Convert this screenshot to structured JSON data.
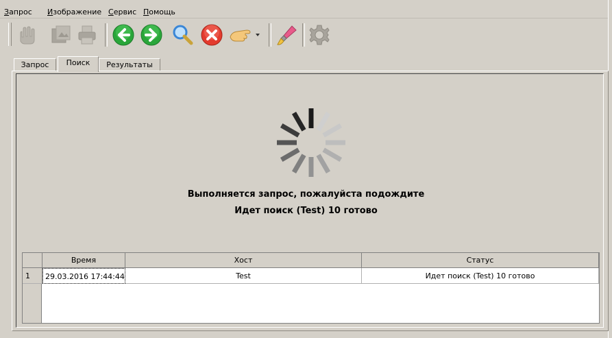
{
  "menu": {
    "items": [
      {
        "mnemonic": "З",
        "rest": "апрос"
      },
      {
        "mnemonic": "И",
        "rest": "зображение"
      },
      {
        "mnemonic": "С",
        "rest": "ервис"
      },
      {
        "mnemonic": "П",
        "rest": "омощь"
      }
    ]
  },
  "toolbar": {
    "icons": [
      "hand-disabled-icon",
      "image-disabled-icon",
      "printer-disabled-icon",
      "back-arrow-icon",
      "forward-arrow-icon",
      "magnifier-icon",
      "stop-icon",
      "pointing-hand-icon",
      "brush-icon",
      "gear-icon"
    ],
    "colors": {
      "green": "#2aa63a",
      "red": "#e33b2e",
      "blue": "#3a86d6"
    }
  },
  "tabs": [
    {
      "label": "Запрос"
    },
    {
      "label": "Поиск"
    },
    {
      "label": "Результаты"
    }
  ],
  "active_tab": "Поиск",
  "status": {
    "line1": "Выполняется запрос, пожалуйста подождите",
    "line2": "Идет поиск (Test) 10 готово"
  },
  "grid": {
    "columns": [
      "Время",
      "Хост",
      "Статус"
    ],
    "rows": [
      {
        "num": "1",
        "time": "29.03.2016 17:44:44",
        "host": "Test",
        "status": "Идет поиск (Test) 10 готово"
      }
    ]
  }
}
